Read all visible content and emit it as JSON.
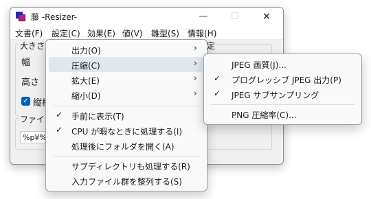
{
  "window": {
    "title": "藤 -Resizer-",
    "min_glyph": "—",
    "max_glyph": "☐",
    "close_glyph": "✕"
  },
  "menubar": {
    "items": [
      "文書(F)",
      "設定(C)",
      "効果(E)",
      "値(V)",
      "雛型(S)",
      "情報(H)"
    ]
  },
  "main": {
    "size_group_title": "大きさ",
    "width_label": "幅",
    "height_label": "高さ",
    "aspect_label": "縦横",
    "right_group_title": "定",
    "file_group_title": "ファイル",
    "filename_value": "%p¥%n"
  },
  "menu_settings": {
    "items": [
      {
        "label": "出力(O)",
        "submenu": true
      },
      {
        "label": "圧縮(C)",
        "submenu": true,
        "highlighted": true
      },
      {
        "label": "拡大(E)",
        "submenu": true
      },
      {
        "label": "縮小(D)",
        "submenu": true
      },
      {
        "label": "手前に表示(T)",
        "checked": true
      },
      {
        "label": "CPU が暇なときに処理する(I)",
        "checked": true
      },
      {
        "label": "処理後にフォルダを開く(A)"
      },
      {
        "label": "サブディレクトリも処理する(R)"
      },
      {
        "label": "入力ファイル群を整列する(S)"
      }
    ]
  },
  "menu_compress": {
    "items": [
      {
        "label": "JPEG 画質(J)..."
      },
      {
        "label": "プログレッシブ JPEG 出力(P)",
        "checked": true
      },
      {
        "label": "JPEG サブサンプリング",
        "checked": true
      },
      {
        "label": "PNG 圧縮率(C)..."
      }
    ]
  },
  "glyphs": {
    "check": "✓",
    "arrow": "›"
  },
  "colors": {
    "highlight": "#e2e7ee",
    "checkbox_accent": "#005fb8",
    "icon_blue": "#1d2ad1",
    "icon_magenta": "#d0168c"
  }
}
